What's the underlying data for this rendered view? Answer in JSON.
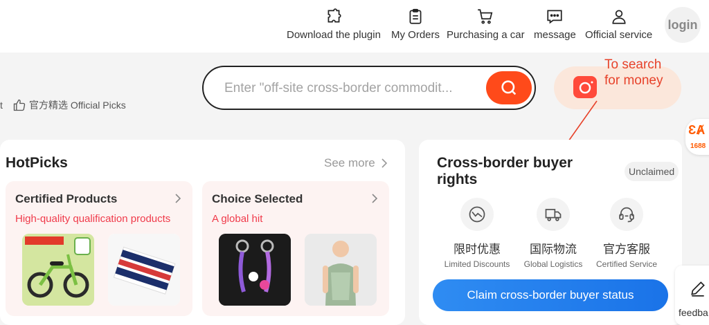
{
  "nav": {
    "items": [
      {
        "label": "Download the plugin",
        "icon": "puzzle-icon"
      },
      {
        "label": "My Orders",
        "icon": "clipboard-icon"
      },
      {
        "label": "Purchasing a car",
        "icon": "cart-icon"
      },
      {
        "label": "message",
        "icon": "chat-icon"
      },
      {
        "label": "Official service",
        "icon": "user-icon"
      }
    ],
    "login_label": "login"
  },
  "search": {
    "left_cut_text": "t",
    "official_picks_label": "官方精选 Official Picks",
    "placeholder": "Enter \"off-site cross-border commodit...",
    "annotation": "To search for money",
    "badge_1688": "1688"
  },
  "hotpicks": {
    "title": "HotPicks",
    "see_more": "See more",
    "cards": [
      {
        "title": "Certified Products",
        "desc": "High-quality qualification products"
      },
      {
        "title": "Choice Selected",
        "desc": "A global hit"
      }
    ]
  },
  "crossborder": {
    "title": "Cross-border buyer rights",
    "status": "Unclaimed",
    "benefits": [
      {
        "cn": "限时优惠",
        "en": "Limited Discounts",
        "icon": "discount-icon"
      },
      {
        "cn": "国际物流",
        "en": "Global Logistics",
        "icon": "truck-icon"
      },
      {
        "cn": "官方客服",
        "en": "Certified Service",
        "icon": "headset-icon"
      }
    ],
    "claim_button": "Claim cross-border buyer status"
  },
  "feedback": {
    "label": "feedba"
  },
  "colors": {
    "accent": "#ff4a1a",
    "annotation": "#e7422a",
    "claim_blue": "#1a73e8",
    "desc_red": "#f03a4a"
  }
}
